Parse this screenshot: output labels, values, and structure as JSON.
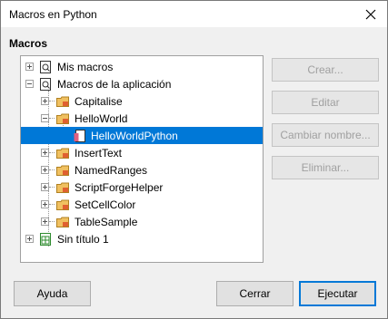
{
  "window": {
    "title": "Macros en Python"
  },
  "section_label": "Macros",
  "tree": [
    {
      "label": "Mis macros",
      "icon": "macro-library-icon",
      "expander": "plus"
    },
    {
      "label": "Macros de la aplicación",
      "icon": "macro-library-icon",
      "expander": "minus"
    },
    {
      "label": "Capitalise",
      "icon": "folder-icon",
      "expander": "plus"
    },
    {
      "label": "HelloWorld",
      "icon": "folder-icon",
      "expander": "minus"
    },
    {
      "label": "HelloWorldPython",
      "icon": "module-icon",
      "expander": "none",
      "selected": true
    },
    {
      "label": "InsertText",
      "icon": "folder-icon",
      "expander": "plus"
    },
    {
      "label": "NamedRanges",
      "icon": "folder-icon",
      "expander": "plus"
    },
    {
      "label": "ScriptForgeHelper",
      "icon": "folder-icon",
      "expander": "plus"
    },
    {
      "label": "SetCellColor",
      "icon": "folder-icon",
      "expander": "plus"
    },
    {
      "label": "TableSample",
      "icon": "folder-icon",
      "expander": "plus"
    },
    {
      "label": "Sin título 1",
      "icon": "spreadsheet-document-icon",
      "expander": "plus"
    }
  ],
  "buttons": {
    "create": {
      "label": "Crear...",
      "disabled": true
    },
    "edit": {
      "label": "Editar",
      "disabled": true
    },
    "rename": {
      "label": "Cambiar nombre...",
      "disabled": true
    },
    "delete": {
      "label": "Eliminar...",
      "disabled": true
    },
    "help": {
      "label": "Ayuda"
    },
    "close": {
      "label": "Cerrar"
    },
    "run": {
      "label": "Ejecutar"
    }
  },
  "colors": {
    "selection": "#0078d7",
    "folder": "#f0c060"
  }
}
